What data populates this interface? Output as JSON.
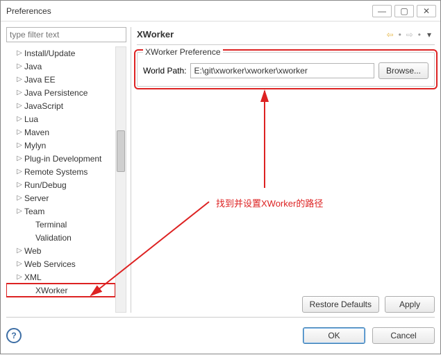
{
  "window": {
    "title": "Preferences"
  },
  "filter": {
    "placeholder": "type filter text"
  },
  "tree": {
    "items": [
      {
        "label": "Install/Update",
        "expandable": true
      },
      {
        "label": "Java",
        "expandable": true
      },
      {
        "label": "Java EE",
        "expandable": true
      },
      {
        "label": "Java Persistence",
        "expandable": true
      },
      {
        "label": "JavaScript",
        "expandable": true
      },
      {
        "label": "Lua",
        "expandable": true
      },
      {
        "label": "Maven",
        "expandable": true
      },
      {
        "label": "Mylyn",
        "expandable": true
      },
      {
        "label": "Plug-in Development",
        "expandable": true
      },
      {
        "label": "Remote Systems",
        "expandable": true
      },
      {
        "label": "Run/Debug",
        "expandable": true
      },
      {
        "label": "Server",
        "expandable": true
      },
      {
        "label": "Team",
        "expandable": true
      },
      {
        "label": "Terminal",
        "expandable": false,
        "child": true
      },
      {
        "label": "Validation",
        "expandable": false,
        "child": true
      },
      {
        "label": "Web",
        "expandable": true
      },
      {
        "label": "Web Services",
        "expandable": true
      },
      {
        "label": "XML",
        "expandable": true
      },
      {
        "label": "XWorker",
        "expandable": false,
        "child": true,
        "selected": true
      }
    ]
  },
  "right": {
    "title": "XWorker",
    "group_legend": "XWorker Preference",
    "world_path_label": "World Path:",
    "world_path_value": "E:\\git\\xworker\\xworker\\xworker",
    "browse": "Browse...",
    "restore": "Restore Defaults",
    "apply": "Apply"
  },
  "buttons": {
    "ok": "OK",
    "cancel": "Cancel"
  },
  "annotation": {
    "text": "找到并设置XWorker的路径"
  },
  "icons": {
    "back_glyph": "⇦",
    "fwd_glyph": "⇨",
    "menu_glyph": "▾",
    "twisty": "▷",
    "min": "—",
    "max": "▢",
    "close": "✕",
    "help": "?"
  },
  "colors": {
    "accent_red": "#d22",
    "back_arrow": "#e6b84a"
  }
}
